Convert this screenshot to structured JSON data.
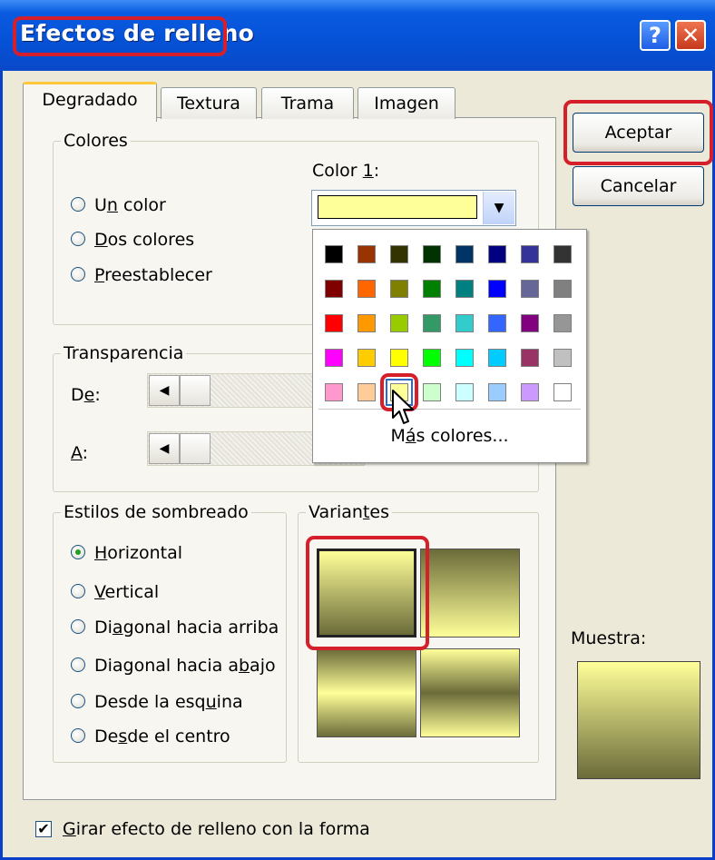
{
  "window": {
    "title": "Efectos de relleno",
    "help_button": "?",
    "close_button": "✕"
  },
  "tabs": [
    {
      "label": "Degradado",
      "active": true
    },
    {
      "label": "Textura",
      "active": false
    },
    {
      "label": "Trama",
      "active": false
    },
    {
      "label": "Imagen",
      "active": false
    }
  ],
  "buttons": {
    "accept": "Aceptar",
    "cancel": "Cancelar"
  },
  "colors_group": {
    "title": "Colores",
    "options": [
      {
        "pre": "U",
        "ul": "n",
        "post": " color",
        "selected": true
      },
      {
        "pre": "",
        "ul": "D",
        "post": "os colores",
        "selected": false
      },
      {
        "pre": "",
        "ul": "P",
        "post": "reestablecer",
        "selected": false
      }
    ],
    "color1_label_pre": "Color ",
    "color1_label_ul": "1",
    "color1_label_post": ":",
    "color1_value": "#ffff99"
  },
  "palette": {
    "rows": [
      [
        "#000000",
        "#993300",
        "#333300",
        "#003300",
        "#003366",
        "#000080",
        "#333399",
        "#333333"
      ],
      [
        "#800000",
        "#ff6600",
        "#808000",
        "#008000",
        "#008080",
        "#0000ff",
        "#666699",
        "#808080"
      ],
      [
        "#ff0000",
        "#ff9900",
        "#99cc00",
        "#339966",
        "#33cccc",
        "#3366ff",
        "#800080",
        "#969696"
      ],
      [
        "#ff00ff",
        "#ffcc00",
        "#ffff00",
        "#00ff00",
        "#00ffff",
        "#00ccff",
        "#993366",
        "#c0c0c0"
      ],
      [
        "#ff99cc",
        "#ffcc99",
        "#ffff99",
        "#ccffcc",
        "#ccffff",
        "#99ccff",
        "#cc99ff",
        "#ffffff"
      ]
    ],
    "selected_row": 4,
    "selected_col": 2,
    "more_pre": "M",
    "more_ul": "á",
    "more_post": "s colores..."
  },
  "transparency": {
    "title": "Transparencia",
    "from_pre": "D",
    "from_ul": "e",
    "from_post": ":",
    "to_ul": "A",
    "to_post": ":"
  },
  "shading": {
    "title": "Estilos de sombreado",
    "options": [
      {
        "pre": "",
        "ul": "H",
        "post": "orizontal",
        "selected": true
      },
      {
        "pre": "",
        "ul": "V",
        "post": "ertical",
        "selected": false
      },
      {
        "pre": "Di",
        "ul": "a",
        "post": "gonal hacia arriba",
        "selected": false
      },
      {
        "pre": "Diagonal hacia a",
        "ul": "b",
        "post": "ajo",
        "selected": false
      },
      {
        "pre": "Desde la esq",
        "ul": "u",
        "post": "ina",
        "selected": false
      },
      {
        "pre": "De",
        "ul": "s",
        "post": "de el centro",
        "selected": false
      }
    ]
  },
  "variants": {
    "title_pre": "Varian",
    "title_ul": "t",
    "title_post": "es",
    "light": "#ffff99",
    "dark": "#6b6b3a"
  },
  "sample": {
    "label": "Muestra:"
  },
  "rotate_checkbox": {
    "pre": "",
    "ul": "G",
    "post": "irar efecto de relleno con la forma",
    "checked": true
  }
}
